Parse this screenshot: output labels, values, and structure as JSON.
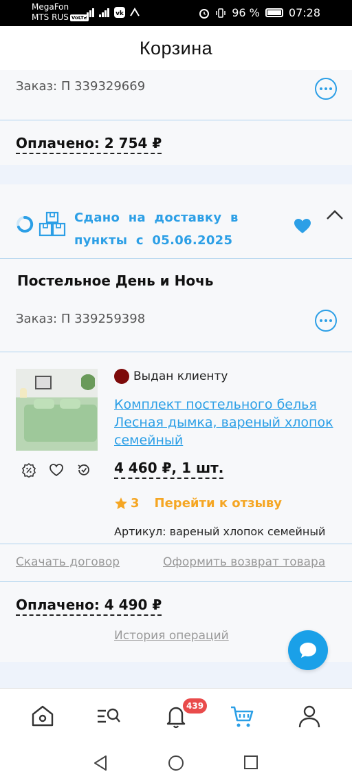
{
  "status_bar": {
    "carrier1": "MegaFon",
    "carrier2": "MTS RUS",
    "volte": "VoLTE",
    "battery": "96 %",
    "time": "07:28"
  },
  "header": {
    "title": "Корзина"
  },
  "order1": {
    "order_number": "Заказ: П 339329669",
    "paid": "Оплачено: 2 754 ₽"
  },
  "order2": {
    "status": "Сдано на доставку в пункты с 05.06.2025",
    "product_title": "Постельное День и Ночь",
    "order_number": "Заказ: П 339259398",
    "item": {
      "status": "Выдан клиенту",
      "name": "Комплект постельного белья Лесная дымка, вареный хлопок семейный",
      "price": "4 460 ₽, 1 шт.",
      "rating": "3",
      "review_link": "Перейти к отзыву",
      "article": "Артикул: вареный хлопок семейный"
    },
    "download_contract": "Скачать договор",
    "return_goods": "Оформить возврат товара",
    "paid": "Оплачено: 4 490 ₽",
    "history": "История операций"
  },
  "bottom_nav": {
    "items": [
      "home-icon",
      "catalog-search-icon",
      "bell-icon",
      "cart-icon",
      "profile-icon"
    ],
    "notifications_count": "439",
    "active": "cart"
  },
  "colors": {
    "accent": "#2c9fe6",
    "warning": "#f5a623",
    "badge": "#e94b4b",
    "delivered_dot": "#7d0a0a"
  }
}
